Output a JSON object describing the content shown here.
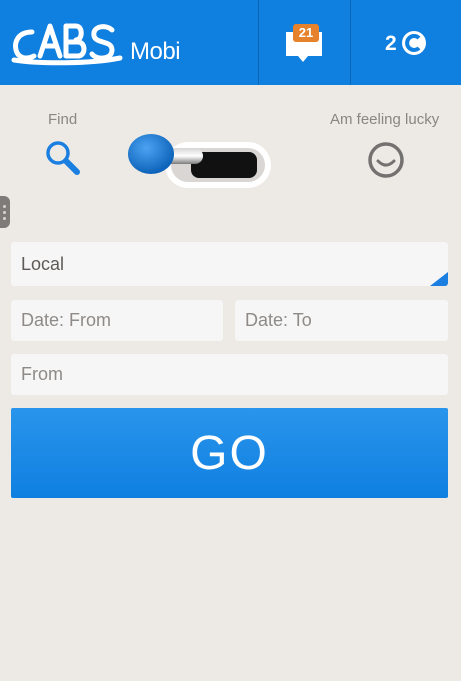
{
  "header": {
    "logo_mark": "CABS",
    "logo_word": "Mobi",
    "notifications": {
      "count": "21",
      "icon": "chat-bubble-icon"
    },
    "credits": {
      "value": "2",
      "icon": "c-coin-icon"
    },
    "colors": {
      "bar": "#0f7fe0",
      "badge": "#e6822c"
    }
  },
  "mode": {
    "find_label": "Find",
    "lucky_label": "Am feeling lucky",
    "find_icon": "search-icon",
    "lucky_icon": "smiley-icon",
    "toggle_state": "find"
  },
  "form": {
    "location_value": "Local",
    "date_from_placeholder": "Date: From",
    "date_to_placeholder": "Date: To",
    "from_placeholder": "From",
    "submit_label": "GO"
  }
}
